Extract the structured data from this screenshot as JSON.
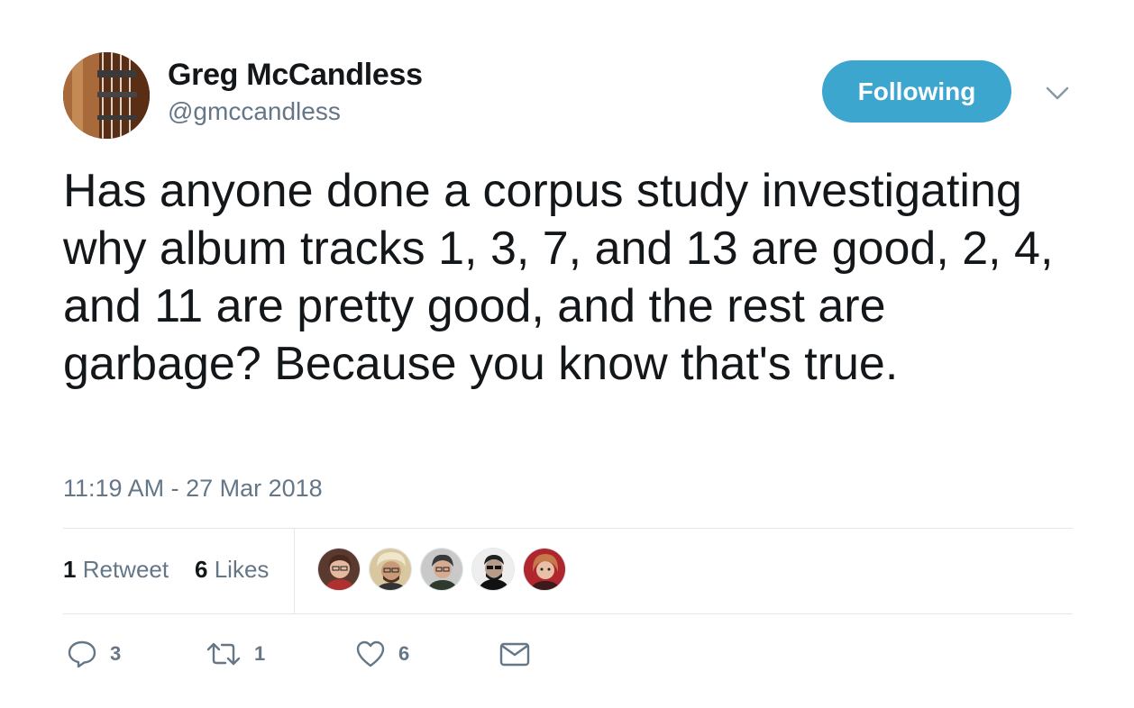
{
  "tweet": {
    "author_name": "Greg McCandless",
    "author_handle": "@gmccandless",
    "follow_label": "Following",
    "text": "Has anyone done a corpus study investigating why album tracks 1, 3, 7, and 13 are good, 2, 4, and 11 are pretty good, and the rest are garbage? Because you know that's true.",
    "timestamp": "11:19 AM - 27 Mar 2018"
  },
  "stats": {
    "retweet_count": "1",
    "retweet_label": "Retweet",
    "like_count": "6",
    "like_label": "Likes"
  },
  "actions": {
    "reply_count": "3",
    "retweet_count": "1",
    "like_count": "6"
  },
  "icons": {
    "caret": "chevron-down-icon",
    "reply": "reply-icon",
    "retweet": "retweet-icon",
    "like": "heart-icon",
    "dm": "envelope-icon"
  },
  "colors": {
    "accent": "#3da6cf",
    "text": "#14171a",
    "secondary": "#657786",
    "divider": "#e1e8ed"
  }
}
